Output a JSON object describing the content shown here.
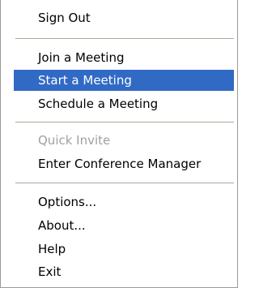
{
  "menu": {
    "items": [
      {
        "label": "Sign Out",
        "state": "normal"
      },
      {
        "label": "Join a Meeting",
        "state": "normal"
      },
      {
        "label": "Start a Meeting",
        "state": "selected"
      },
      {
        "label": "Schedule a Meeting",
        "state": "normal"
      },
      {
        "label": "Quick Invite",
        "state": "disabled"
      },
      {
        "label": "Enter Conference Manager",
        "state": "normal"
      },
      {
        "label": "Options...",
        "state": "normal"
      },
      {
        "label": "About...",
        "state": "normal"
      },
      {
        "label": "Help",
        "state": "normal"
      },
      {
        "label": "Exit",
        "state": "normal"
      }
    ],
    "colors": {
      "highlight": "#316ac5",
      "highlight_text": "#ffffff",
      "disabled_text": "#a0a0a0",
      "separator": "#aca899"
    }
  }
}
